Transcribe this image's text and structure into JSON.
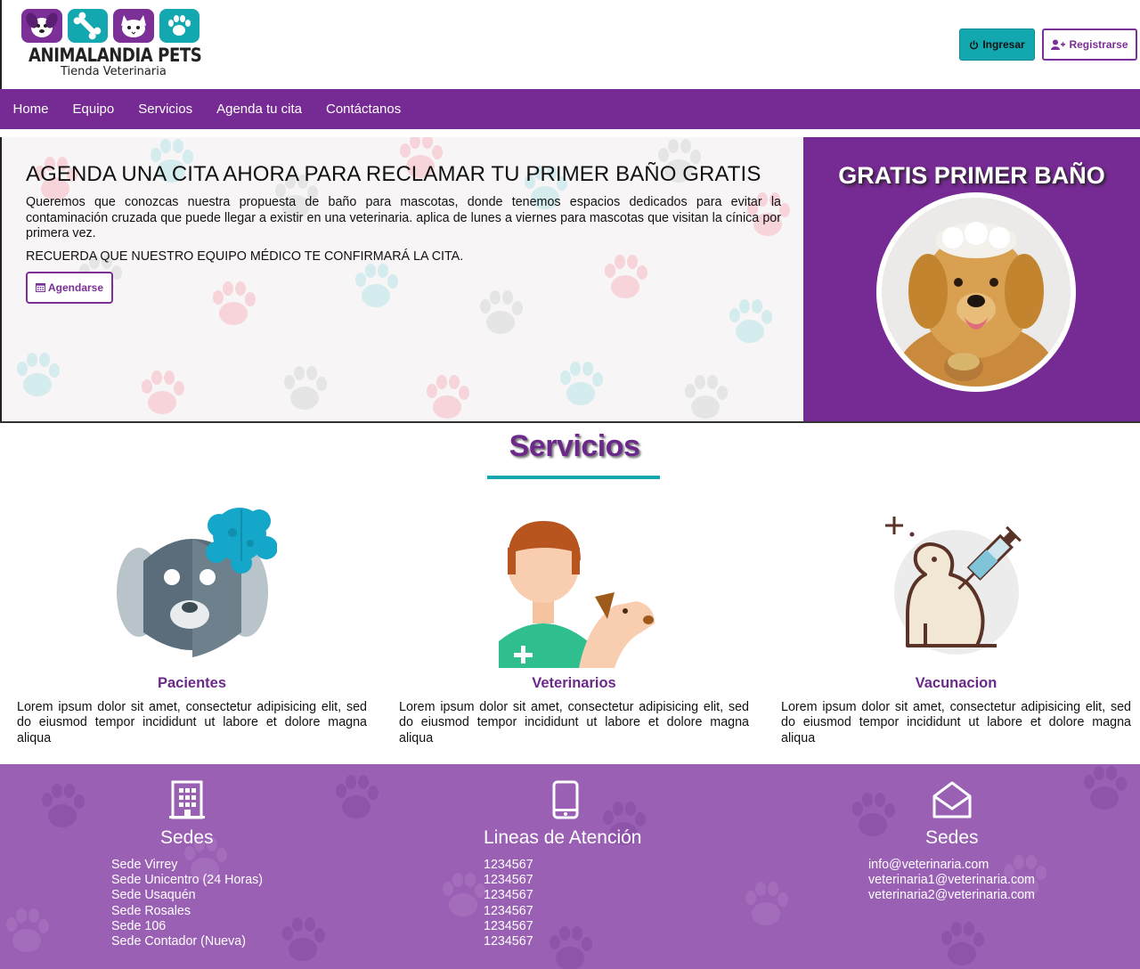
{
  "brand": {
    "name": "ANIMALANDIA PETS",
    "subtitle": "Tienda Veterinaria"
  },
  "header": {
    "login_label": "Ingresar",
    "register_label": "Registrarse"
  },
  "nav": {
    "items": [
      "Home",
      "Equipo",
      "Servicios",
      "Agenda tu cita",
      "Contáctanos"
    ]
  },
  "hero": {
    "title": "AGENDA UNA CITA AHORA PARA RECLAMAR TU PRIMER BAÑO GRATIS",
    "text": "Queremos que conozcas nuestra propuesta de baño para mascotas, donde tenemos espacios dedicados para evitar la contaminación cruzada que puede llegar a existir en una veterinaria. aplica de lunes a viernes para mascotas que visitan la cínica por primera vez.",
    "reminder": "RECUERDA QUE NUESTRO EQUIPO MÉDICO TE CONFIRMARÁ LA CITA.",
    "button_label": "Agendarse"
  },
  "promo": {
    "title": "GRATIS PRIMER BAÑO"
  },
  "services": {
    "title": "Servicios",
    "items": [
      {
        "name": "Pacientes",
        "description": "Lorem ipsum dolor sit amet, consectetur adipisicing elit, sed do eiusmod tempor incididunt ut labore et dolore magna aliqua"
      },
      {
        "name": "Veterinarios",
        "description": "Lorem ipsum dolor sit amet, consectetur adipisicing elit, sed do eiusmod tempor incididunt ut labore et dolore magna aliqua"
      },
      {
        "name": "Vacunacion",
        "description": "Lorem ipsum dolor sit amet, consectetur adipisicing elit, sed do eiusmod tempor incididunt ut labore et dolore magna aliqua"
      }
    ]
  },
  "footer": {
    "locations": {
      "title": "Sedes",
      "icon": "building-icon",
      "items": [
        "Sede Virrey",
        "Sede Unicentro (24 Horas)",
        "Sede Usaquén",
        "Sede Rosales",
        "Sede 106",
        "Sede Contador (Nueva)"
      ]
    },
    "phones": {
      "title": "Lineas de Atención",
      "icon": "mobile-phone-icon",
      "items": [
        "1234567",
        "1234567",
        "1234567",
        "1234567",
        "1234567",
        "1234567"
      ]
    },
    "emails": {
      "title": "Sedes",
      "icon": "envelope-open-icon",
      "items": [
        "info@veterinaria.com",
        "veterinaria1@veterinaria.com",
        "veterinaria2@veterinaria.com"
      ]
    }
  },
  "colors": {
    "primary_purple": "#762a93",
    "accent_teal": "#13a8b0",
    "footer_purple": "#9a60b4"
  }
}
